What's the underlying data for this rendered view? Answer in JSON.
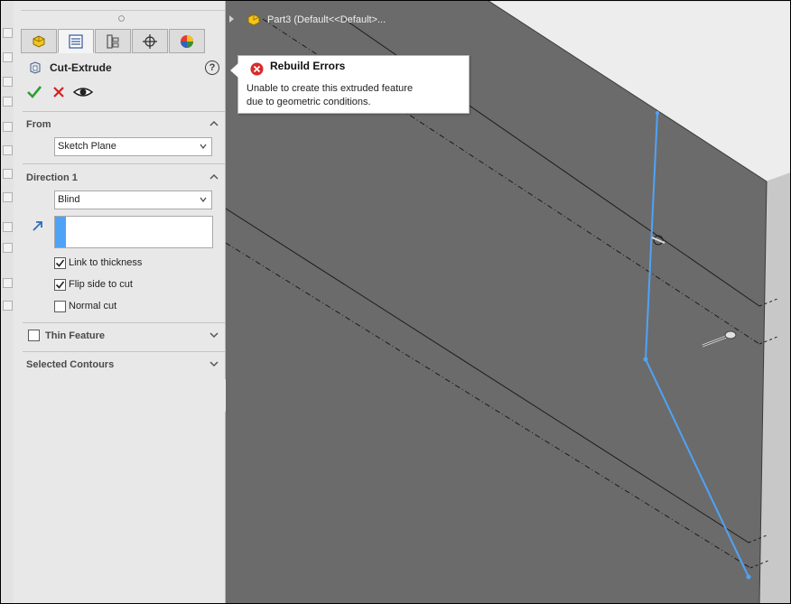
{
  "panel": {
    "title": "Cut-Extrude",
    "tabs": [
      {
        "icon": "part-icon"
      },
      {
        "icon": "property-manager-icon"
      },
      {
        "icon": "configuration-manager-icon"
      },
      {
        "icon": "dimxpert-icon"
      },
      {
        "icon": "display-manager-icon"
      }
    ],
    "from": {
      "label": "From",
      "value": "Sketch Plane"
    },
    "direction1": {
      "label": "Direction 1",
      "end_condition": "Blind",
      "depth_value": "",
      "link_to_thickness": {
        "label": "Link to thickness",
        "checked": true
      },
      "flip_side_to_cut": {
        "label": "Flip side to cut",
        "checked": true
      },
      "normal_cut": {
        "label": "Normal cut",
        "checked": false
      }
    },
    "thin_feature": {
      "label": "Thin Feature",
      "checked": false
    },
    "selected_contours": {
      "label": "Selected Contours"
    }
  },
  "tree": {
    "label": "Part3  (Default<<Default>..."
  },
  "error": {
    "title": "Rebuild Errors",
    "line1": "Unable to create this extruded feature",
    "line2": "due to geometric conditions."
  },
  "colors": {
    "accept": "#2e9e2e",
    "cancel": "#d42020",
    "sketch": "#4fa3f7",
    "model_face": "#6b6b6b",
    "error_icon": "#d92b2b"
  }
}
